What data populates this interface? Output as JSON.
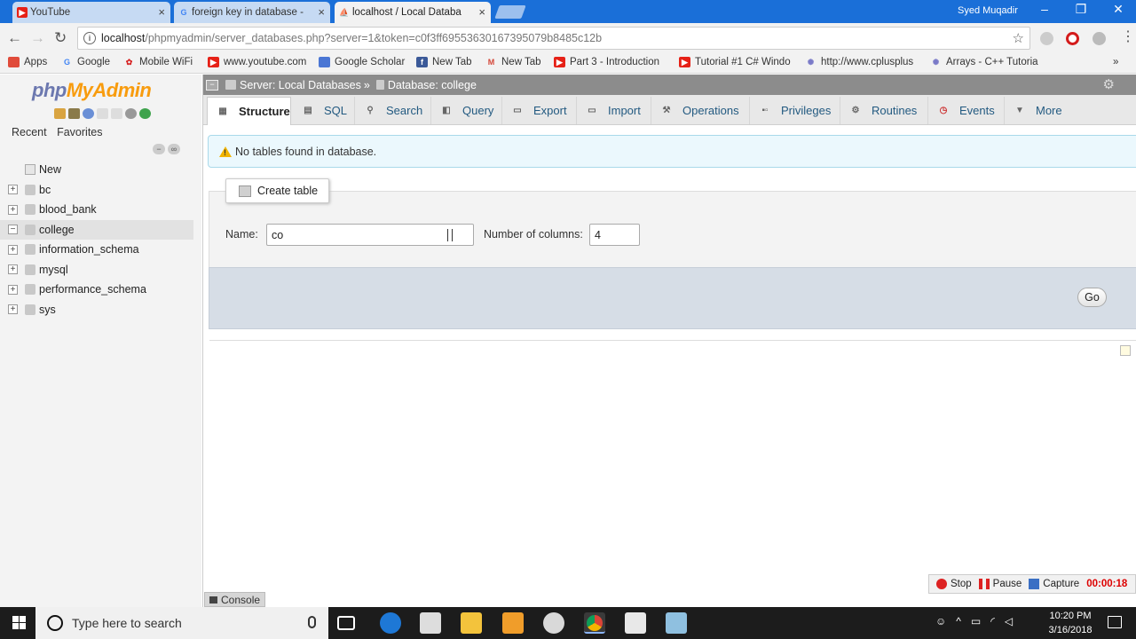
{
  "browser": {
    "tabs": [
      {
        "title": "YouTube",
        "icon": "youtube-icon"
      },
      {
        "title": "foreign key in database -",
        "icon": "google-icon"
      },
      {
        "title": "localhost / Local Databa",
        "icon": "phpmyadmin-icon"
      }
    ],
    "user": "Syed Muqadir",
    "url_host": "localhost",
    "url_path": "/phpmyadmin/server_databases.php?server=1&token=c0f3ff69553630167395079b8485c12b"
  },
  "bookmarks": [
    {
      "label": "Apps",
      "color": "#e04b3a"
    },
    {
      "label": "Google",
      "color": "#4285f4"
    },
    {
      "label": "Mobile WiFi",
      "color": "#d62323"
    },
    {
      "label": "www.youtube.com",
      "color": "#e62117"
    },
    {
      "label": "Google Scholar",
      "color": "#4a76d4"
    },
    {
      "label": "New Tab",
      "color": "#3b5998"
    },
    {
      "label": "New Tab",
      "color": "#d44638"
    },
    {
      "label": "Part 3 - Introduction",
      "color": "#e62117"
    },
    {
      "label": "Tutorial #1 C# Windo",
      "color": "#e62117"
    },
    {
      "label": "http://www.cplusplus",
      "color": "#7a7ac8"
    },
    {
      "label": "Arrays - C++ Tutoria",
      "color": "#7a7ac8"
    }
  ],
  "sidebar": {
    "logo_a": "php",
    "logo_b": "MyAdmin",
    "tab_recent": "Recent",
    "tab_favorites": "Favorites",
    "new_label": "New",
    "databases": [
      "bc",
      "blood_bank",
      "college",
      "information_schema",
      "mysql",
      "performance_schema",
      "sys"
    ],
    "selected": "college"
  },
  "breadcrumb": {
    "server": "Server: Local Databases",
    "sep": "»",
    "database": "Database: college"
  },
  "tabs": [
    {
      "label": "Structure",
      "icon": "structure-icon"
    },
    {
      "label": "SQL",
      "icon": "sql-icon"
    },
    {
      "label": "Search",
      "icon": "search-icon"
    },
    {
      "label": "Query",
      "icon": "query-icon"
    },
    {
      "label": "Export",
      "icon": "export-icon"
    },
    {
      "label": "Import",
      "icon": "import-icon"
    },
    {
      "label": "Operations",
      "icon": "wrench-icon"
    },
    {
      "label": "Privileges",
      "icon": "privileges-icon"
    },
    {
      "label": "Routines",
      "icon": "routines-icon"
    },
    {
      "label": "Events",
      "icon": "clock-icon"
    },
    {
      "label": "More",
      "icon": "chevron-down-icon"
    }
  ],
  "notice": "No tables found in database.",
  "create_table": {
    "legend": "Create table",
    "name_label": "Name:",
    "name_value": "co",
    "columns_label": "Number of columns:",
    "columns_value": "4",
    "go_label": "Go"
  },
  "console_label": "Console",
  "recorder": {
    "stop": "Stop",
    "pause": "Pause",
    "capture": "Capture",
    "time": "00:00:18"
  },
  "taskbar": {
    "search_placeholder": "Type here to search",
    "time": "10:20 PM",
    "date": "3/16/2018"
  }
}
